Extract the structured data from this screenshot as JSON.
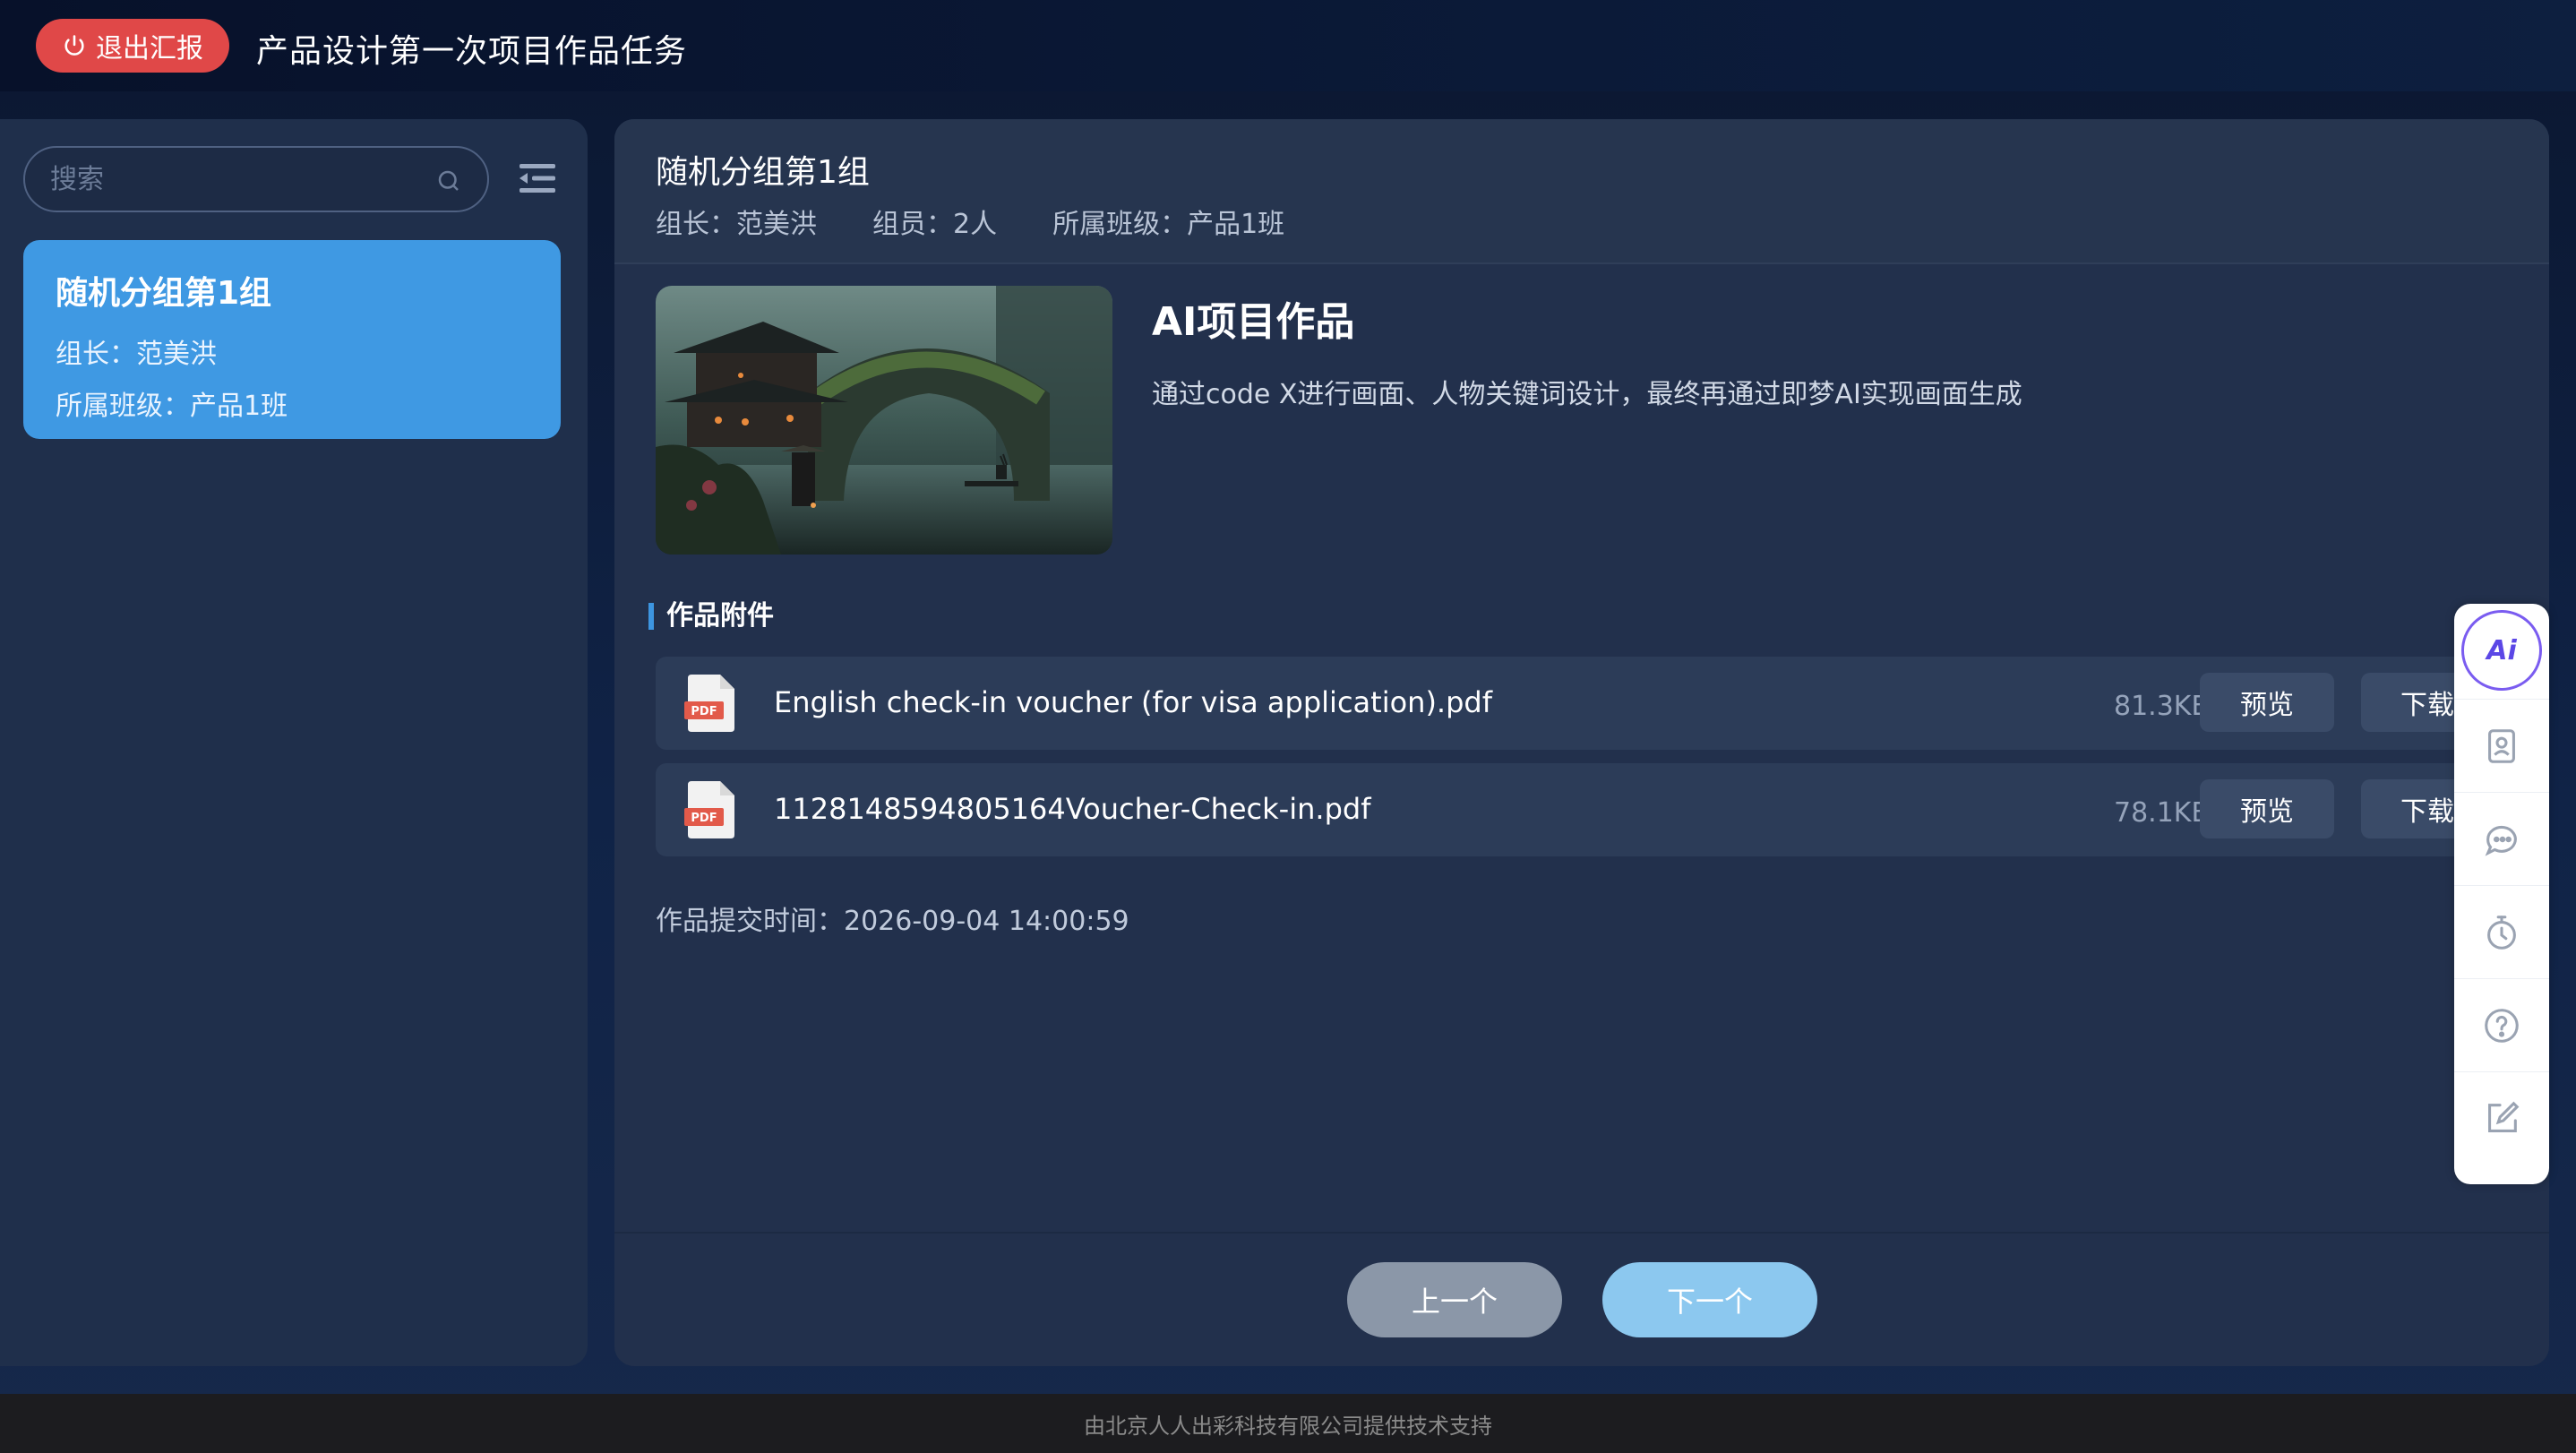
{
  "header": {
    "exit_label": "退出汇报",
    "title": "产品设计第一次项目作品任务"
  },
  "sidebar": {
    "search_placeholder": "搜索",
    "groups": [
      {
        "name": "随机分组第1组",
        "leader": "组长：范美洪",
        "class": "所属班级：产品1班"
      }
    ]
  },
  "main": {
    "group_title": "随机分组第1组",
    "leader": "组长：范美洪",
    "members": "组员：2人",
    "class": "所属班级：产品1班",
    "work_title": "AI项目作品",
    "work_desc": "通过code X进行画面、人物关键词设计，最终再通过即梦AI实现画面生成",
    "attachments_title": "作品附件",
    "attachments": [
      {
        "icon_text": "PDF",
        "name": "English check-in voucher (for visa application).pdf",
        "size": "81.3KB",
        "preview": "预览",
        "download": "下载"
      },
      {
        "icon_text": "PDF",
        "name": "1128148594805164Voucher-Check-in.pdf",
        "size": "78.1KB",
        "preview": "预览",
        "download": "下载"
      }
    ],
    "submit_time": "作品提交时间：2026-09-04 14:00:59",
    "prev_label": "上一个",
    "next_label": "下一个"
  },
  "toolbar": {
    "ai_label": "Ai",
    "icons": [
      "ai-icon",
      "contact-card-icon",
      "chat-icon",
      "timer-icon",
      "help-icon",
      "edit-icon"
    ]
  },
  "footer": {
    "text": "由北京人人出彩科技有限公司提供技术支持"
  },
  "colors": {
    "exit_button": "#e04848",
    "selected_card": "#3f99e3",
    "accent": "#3d95e0",
    "next_button": "#8cc8ef",
    "prev_button": "#8b97a8"
  }
}
